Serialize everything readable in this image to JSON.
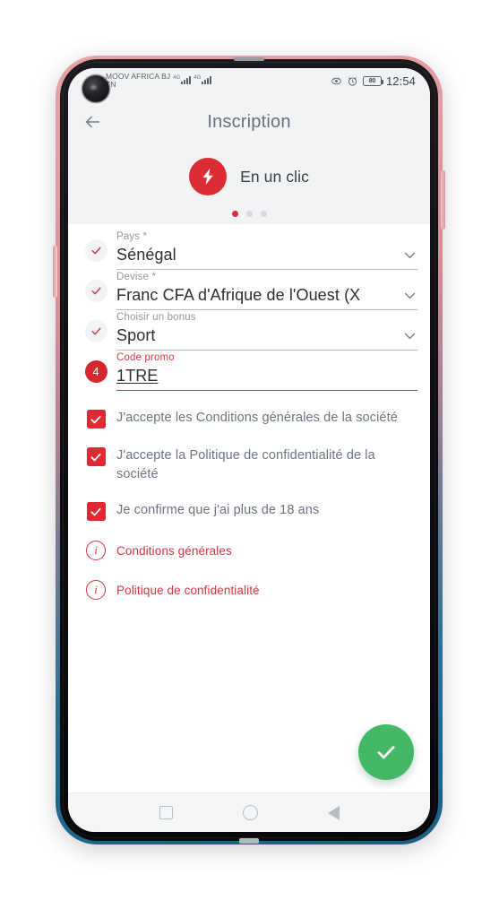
{
  "status_bar": {
    "carrier_line1": "MOOV AFRICA BJ",
    "carrier_line2": "TN",
    "network_type_1": "4G",
    "network_type_2": "4G",
    "battery_level": "80",
    "time": "12:54",
    "icons": [
      "eye-icon",
      "alarm-icon",
      "battery-icon"
    ]
  },
  "appbar": {
    "back_icon": "arrow-left-icon",
    "title": "Inscription"
  },
  "promo": {
    "icon": "lightning-bolt-icon",
    "label": "En un clic",
    "dots_total": 3,
    "dots_active_index": 0,
    "accent_color": "#dc2b34"
  },
  "form": {
    "fields": [
      {
        "lead": "check",
        "lead_value": "",
        "label": "Pays *",
        "value": "Sénégal",
        "chevron": "chevron-down-icon",
        "error": false
      },
      {
        "lead": "check",
        "lead_value": "",
        "label": "Devise *",
        "value": "Franc CFA d'Afrique de l'Ouest (X",
        "chevron": "chevron-down-icon",
        "error": false
      },
      {
        "lead": "check",
        "lead_value": "",
        "label": "Choisir un bonus",
        "value": "Sport",
        "chevron": "chevron-down-icon",
        "error": false
      },
      {
        "lead": "number",
        "lead_value": "4",
        "label": "Code promo",
        "value": "1TRE",
        "chevron": "",
        "error": true
      }
    ],
    "checkboxes": [
      {
        "checked": true,
        "label": "J'accepte les Conditions générales de la société"
      },
      {
        "checked": true,
        "label": "J'accepte la Politique de confidentialité de la société"
      },
      {
        "checked": true,
        "label": "Je confirme que j'ai plus de 18 ans"
      }
    ],
    "info_links": [
      {
        "icon": "info-icon",
        "label": "Conditions générales"
      },
      {
        "icon": "info-icon",
        "label": "Politique de confidentialité"
      }
    ],
    "submit": {
      "icon": "check-icon",
      "color": "#45b866"
    }
  },
  "nav_bar": {
    "items": [
      "recents-square-icon",
      "home-circle-icon",
      "back-triangle-icon"
    ]
  }
}
